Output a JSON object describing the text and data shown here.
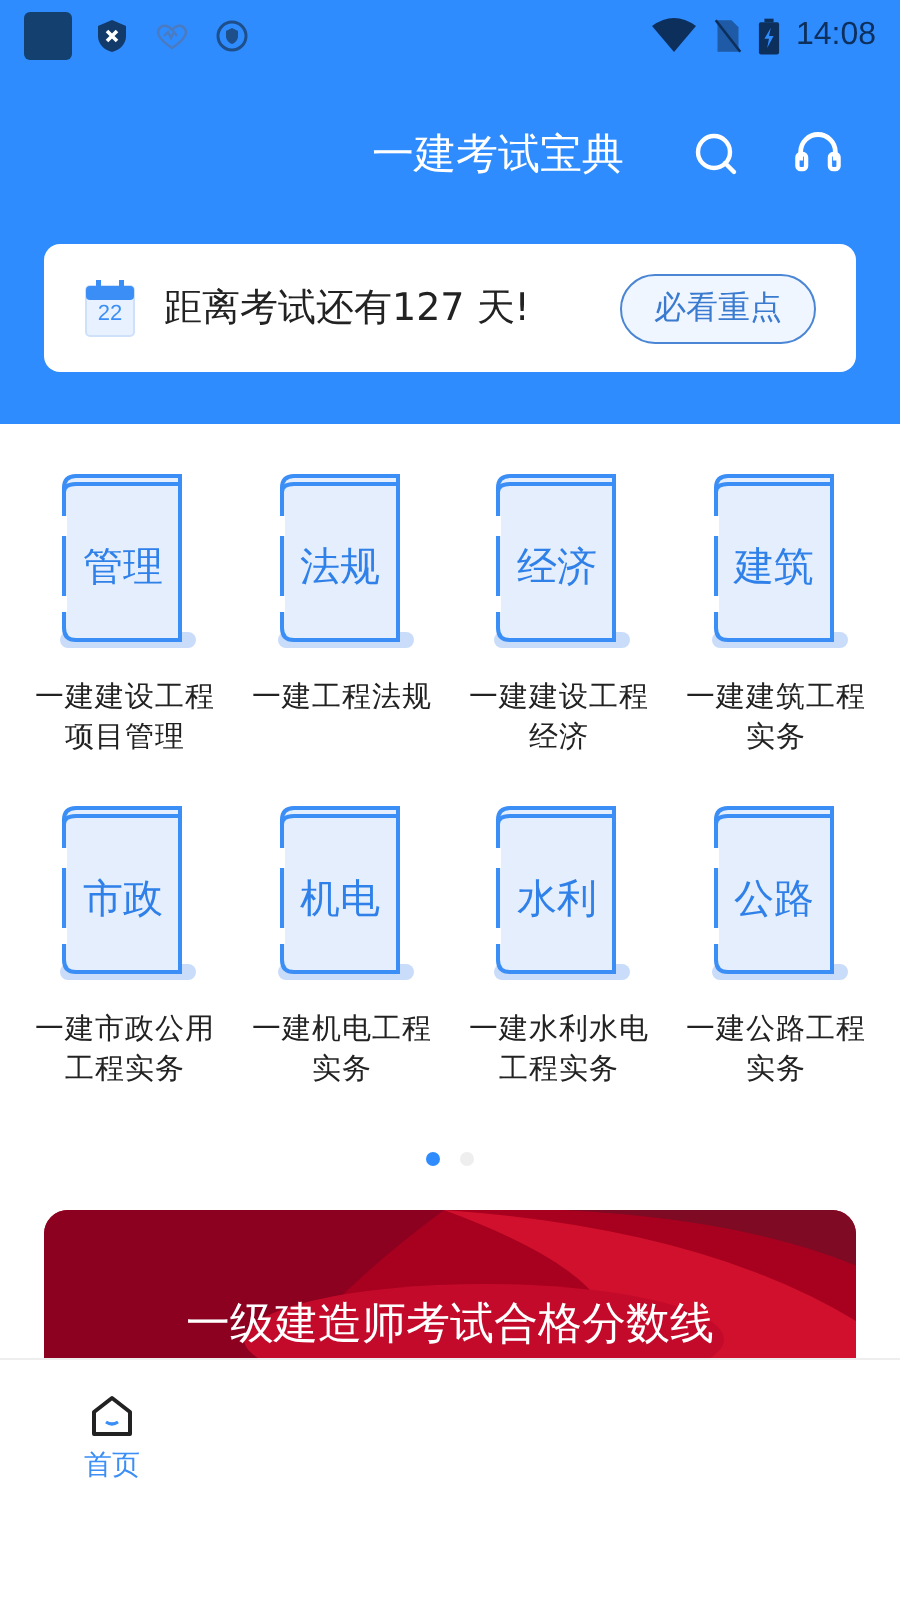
{
  "status_bar": {
    "time": "14:08"
  },
  "header": {
    "title": "一建考试宝典"
  },
  "countdown": {
    "calendar_day": "22",
    "text": "距离考试还有127 天!",
    "button": "必看重点"
  },
  "subjects": [
    {
      "cover": "管理",
      "label": "一建建设工程项目管理"
    },
    {
      "cover": "法规",
      "label": "一建工程法规"
    },
    {
      "cover": "经济",
      "label": "一建建设工程经济"
    },
    {
      "cover": "建筑",
      "label": "一建建筑工程实务"
    },
    {
      "cover": "市政",
      "label": "一建市政公用工程实务"
    },
    {
      "cover": "机电",
      "label": "一建机电工程实务"
    },
    {
      "cover": "水利",
      "label": "一建水利水电工程实务"
    },
    {
      "cover": "公路",
      "label": "一建公路工程实务"
    }
  ],
  "pager": [
    {
      "selected": true
    },
    {
      "selected": false
    }
  ],
  "banner": {
    "title": "一级建造师考试合格分数线"
  },
  "bottom_nav": [
    {
      "label": "首页",
      "selected": true
    }
  ]
}
